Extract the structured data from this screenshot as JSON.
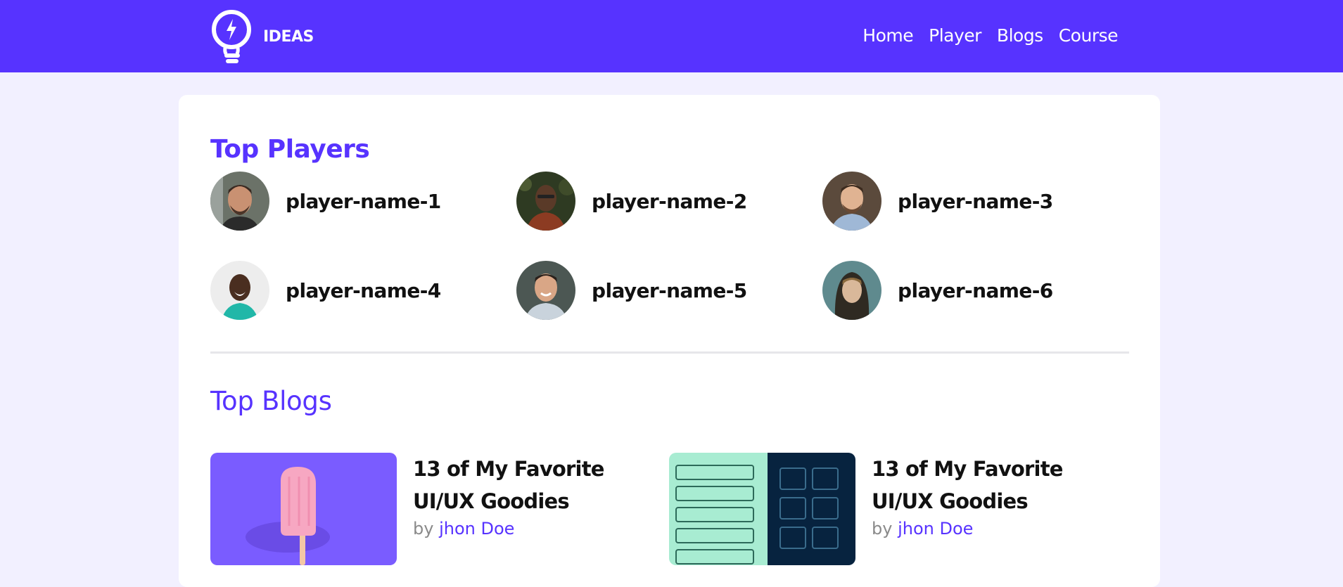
{
  "brand": {
    "name": "IDEAS",
    "logo_icon": "lightbulb-icon"
  },
  "nav": {
    "links": [
      {
        "label": "Home"
      },
      {
        "label": "Player"
      },
      {
        "label": "Blogs"
      },
      {
        "label": "Course"
      }
    ]
  },
  "colors": {
    "primary": "#5733ff",
    "background": "#f2f0ff",
    "card": "#ffffff"
  },
  "players": {
    "title": "Top Players",
    "items": [
      {
        "name": "player-name-1"
      },
      {
        "name": "player-name-2"
      },
      {
        "name": "player-name-3"
      },
      {
        "name": "player-name-4"
      },
      {
        "name": "player-name-5"
      },
      {
        "name": "player-name-6"
      }
    ]
  },
  "blogs": {
    "title": "Top Blogs",
    "items": [
      {
        "title": "13 of My Favorite UI/UX Goodies",
        "by": "by",
        "author": "jhon Doe"
      },
      {
        "title": "13 of My Favorite UI/UX Goodies",
        "by": "by",
        "author": "jhon Doe"
      }
    ]
  }
}
